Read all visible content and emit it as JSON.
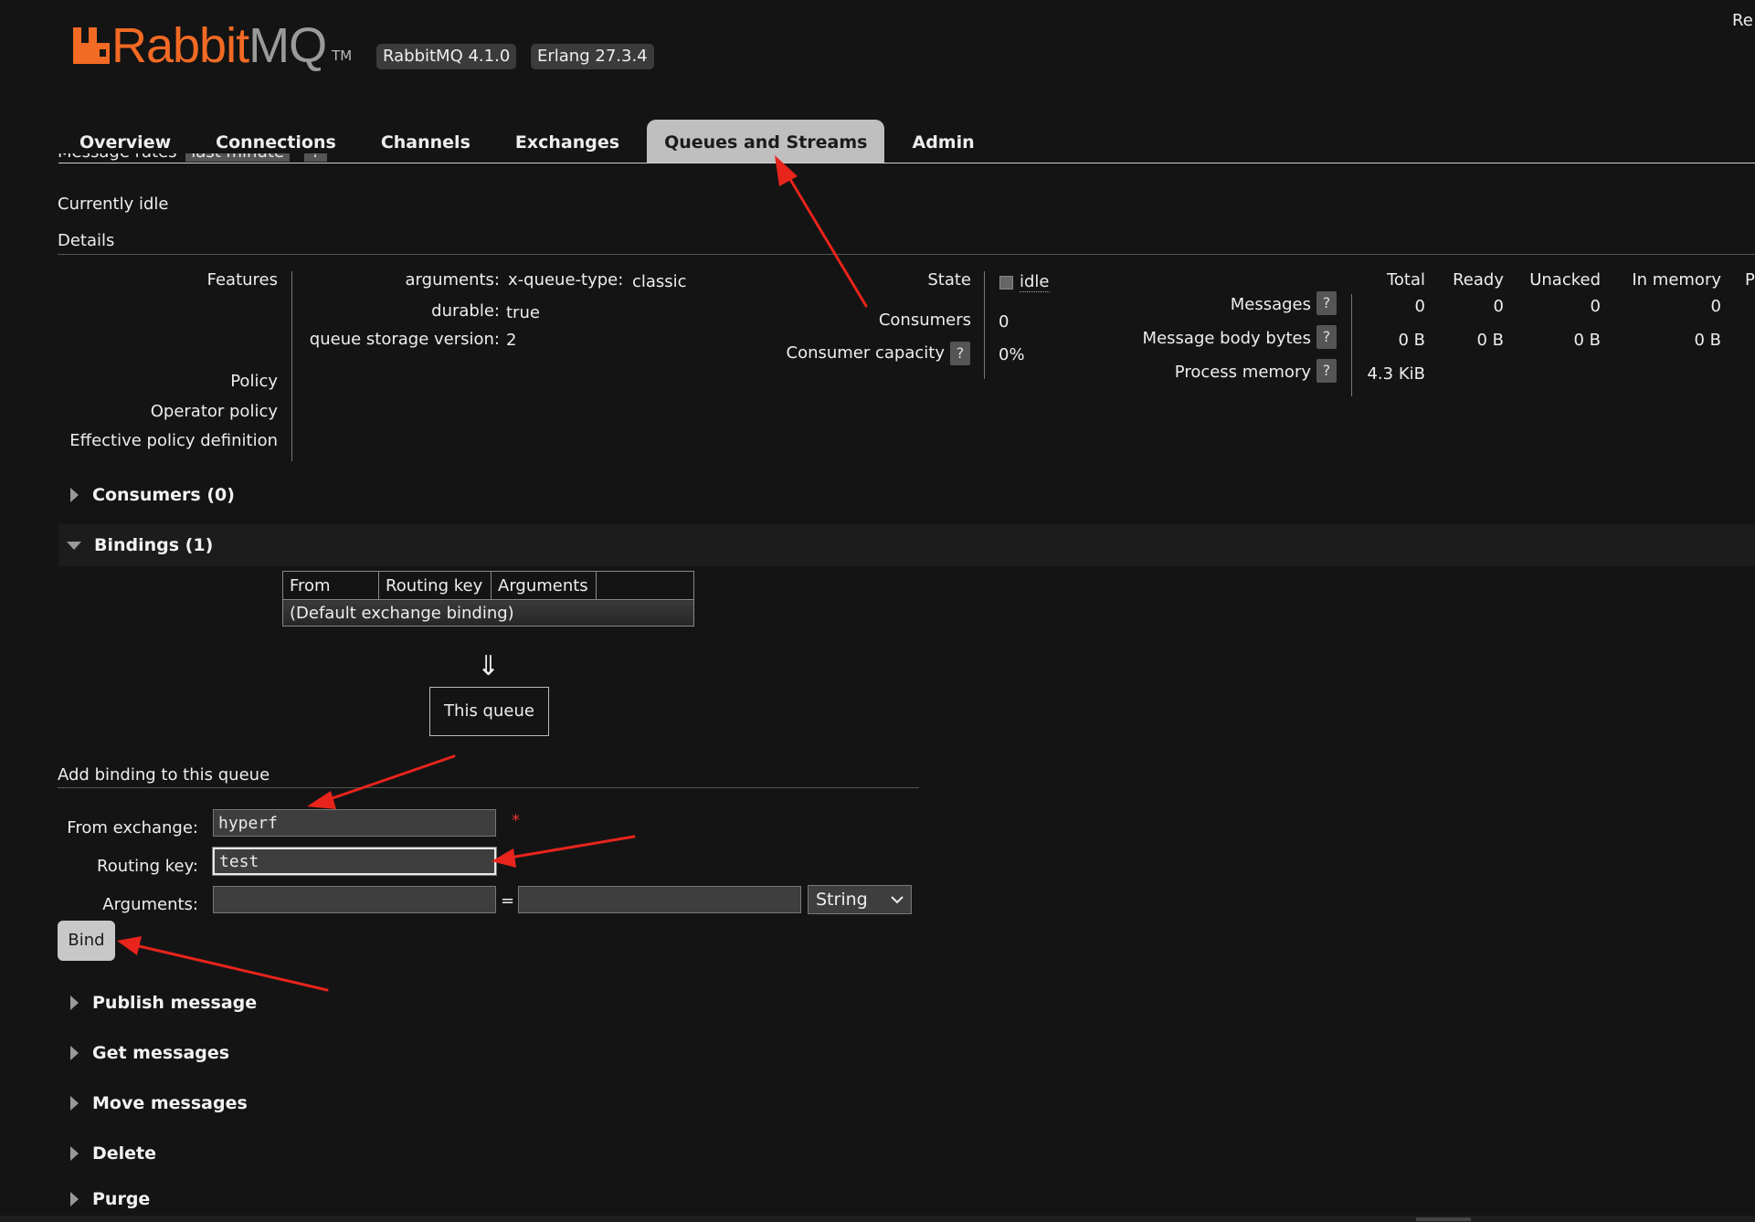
{
  "header": {
    "brand_rabbit": "Rabbit",
    "brand_mq": "MQ",
    "trademark": "TM",
    "rabbitmq_version": "RabbitMQ 4.1.0",
    "erlang_version": "Erlang 27.3.4",
    "top_right_text": "Re"
  },
  "nav": {
    "tabs": [
      "Overview",
      "Connections",
      "Channels",
      "Exchanges",
      "Queues and Streams",
      "Admin"
    ],
    "active": "Queues and Streams"
  },
  "message_rates": {
    "label": "Message rates",
    "period": "last minute",
    "help": "?"
  },
  "status_text": "Currently idle",
  "details": {
    "title": "Details",
    "features_label": "Features",
    "arguments_label": "arguments:",
    "arguments_key": "x-queue-type:",
    "arguments_value": "classic",
    "durable_label": "durable:",
    "durable_value": "true",
    "storage_label": "queue storage version:",
    "storage_value": "2",
    "policy_label": "Policy",
    "operator_policy_label": "Operator policy",
    "effective_policy_label": "Effective policy definition",
    "state_label": "State",
    "state_value": "idle",
    "consumers_label": "Consumers",
    "consumers_value": "0",
    "capacity_label": "Consumer capacity",
    "capacity_value": "0%",
    "help": "?"
  },
  "stats": {
    "columns": [
      "Total",
      "Ready",
      "Unacked",
      "In memory",
      "P"
    ],
    "rows": [
      {
        "label": "Messages",
        "values": [
          "0",
          "0",
          "0",
          "0"
        ]
      },
      {
        "label": "Message body bytes",
        "values": [
          "0 B",
          "0 B",
          "0 B",
          "0 B"
        ]
      },
      {
        "label": "Process memory",
        "values": [
          "4.3 KiB"
        ]
      }
    ]
  },
  "sections": {
    "consumers": "Consumers (0)",
    "bindings": "Bindings (1)",
    "publish": "Publish message",
    "get": "Get messages",
    "move": "Move messages",
    "delete": "Delete",
    "purge": "Purge"
  },
  "bindings_table": {
    "headers": [
      "From",
      "Routing key",
      "Arguments",
      ""
    ],
    "default_row": "(Default exchange binding)",
    "arrow": "⇓",
    "this_queue": "This queue"
  },
  "add_binding": {
    "title": "Add binding to this queue",
    "from_exchange_label": "From exchange:",
    "from_exchange_value": "hyperf",
    "required_mark": "*",
    "routing_key_label": "Routing key:",
    "routing_key_value": "test",
    "arguments_label": "Arguments:",
    "arguments_key_value": "",
    "equals": "=",
    "arguments_value_value": "",
    "type_selected": "String",
    "bind_button": "Bind"
  },
  "colors": {
    "background": "#141414",
    "brand_orange": "#f26a24",
    "active_tab": "#bfbfbf",
    "annotation_red": "#e8241c"
  }
}
